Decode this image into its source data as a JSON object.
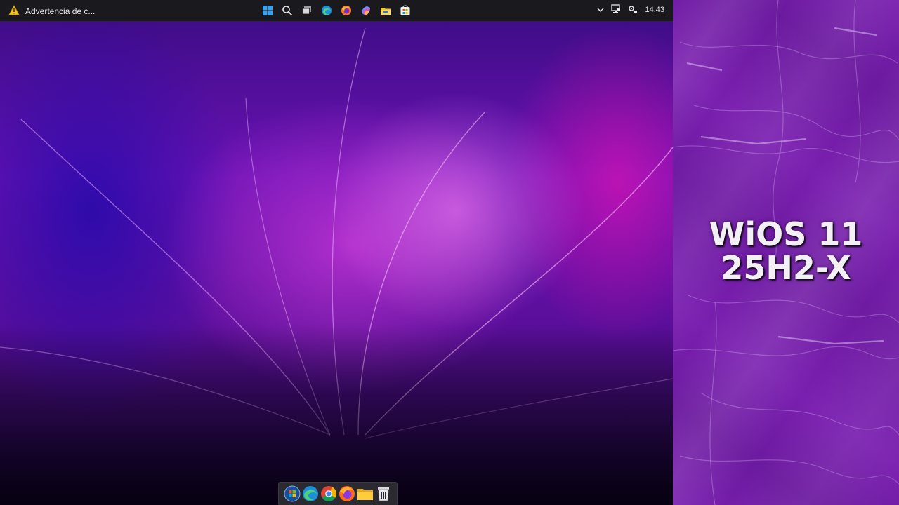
{
  "taskbar": {
    "notification_text": "Advertencia de c...",
    "notification_icon": "warning-icon",
    "pinned_icons": [
      "start-icon",
      "search-icon",
      "task-view-icon",
      "edge-icon",
      "firefox-icon",
      "copilot-icon",
      "file-explorer-icon",
      "store-icon"
    ],
    "tray_icons": [
      "chevron-up-icon",
      "network-icon",
      "settings-icon"
    ],
    "clock": "14:43"
  },
  "dock": {
    "items": [
      "start-orb-icon",
      "edge-icon",
      "chrome-icon",
      "firefox-icon",
      "folder-icon",
      "trash-icon"
    ]
  },
  "side_panel": {
    "title_line1": "WiOS 11",
    "title_line2": "25H2-X"
  },
  "colors": {
    "taskbar_bg": "#1a1a1e",
    "wallpaper_primary": "#7a1ad0",
    "wallpaper_highlight": "#f060e8",
    "panel_bg": "#7a1fb0",
    "text": "#f2f0f4",
    "warning": "#f5c518"
  }
}
